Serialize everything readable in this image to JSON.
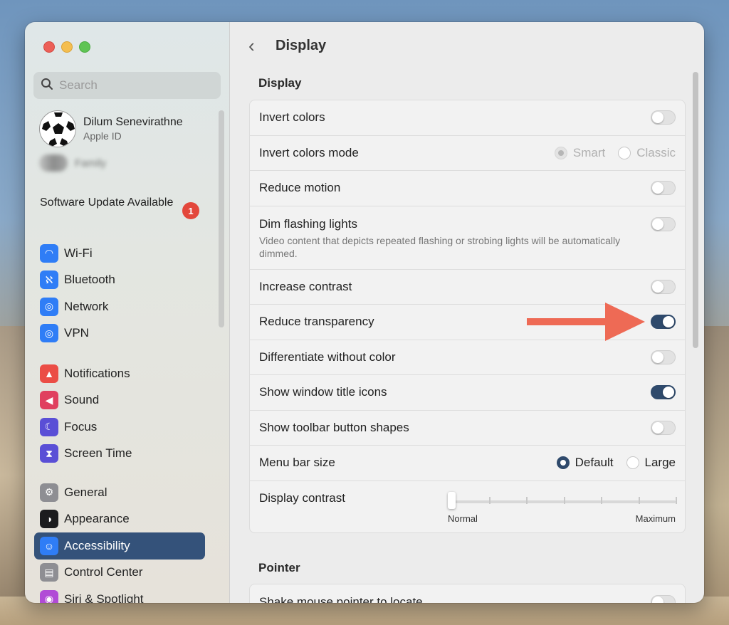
{
  "sidebar": {
    "search_placeholder": "Search",
    "profile": {
      "name": "Dilum Senevirathne",
      "subtitle": "Apple ID"
    },
    "family_label": "Family",
    "update": {
      "text": "Software Update Available",
      "badge": "1"
    },
    "groups": [
      [
        {
          "label": "Wi-Fi",
          "icon": "wifi-icon",
          "color": "#2f7df6",
          "glyph": "◠"
        },
        {
          "label": "Bluetooth",
          "icon": "bluetooth-icon",
          "color": "#2f7df6",
          "glyph": "ℵ"
        },
        {
          "label": "Network",
          "icon": "globe-icon",
          "color": "#2f7df6",
          "glyph": "◎"
        },
        {
          "label": "VPN",
          "icon": "vpn-globe-icon",
          "color": "#2f7df6",
          "glyph": "◎"
        }
      ],
      [
        {
          "label": "Notifications",
          "icon": "bell-icon",
          "color": "#eb4d45",
          "glyph": "▲"
        },
        {
          "label": "Sound",
          "icon": "speaker-icon",
          "color": "#e0405f",
          "glyph": "◀"
        },
        {
          "label": "Focus",
          "icon": "moon-icon",
          "color": "#5a4fd6",
          "glyph": "☾"
        },
        {
          "label": "Screen Time",
          "icon": "hourglass-icon",
          "color": "#5a4fd6",
          "glyph": "⧗"
        }
      ],
      [
        {
          "label": "General",
          "icon": "gear-icon",
          "color": "#8e8e93",
          "glyph": "⚙"
        },
        {
          "label": "Appearance",
          "icon": "appearance-icon",
          "color": "#1c1c1e",
          "glyph": "◑"
        },
        {
          "label": "Accessibility",
          "icon": "accessibility-icon",
          "color": "#2f7df6",
          "glyph": "☺",
          "active": true
        },
        {
          "label": "Control Center",
          "icon": "control-center-icon",
          "color": "#8e8e93",
          "glyph": "▤"
        },
        {
          "label": "Siri & Spotlight",
          "icon": "siri-icon",
          "color": "#b14bd6",
          "glyph": "◉"
        }
      ]
    ]
  },
  "main": {
    "title": "Display",
    "back_label": "‹",
    "display_section": "Display",
    "rows": [
      {
        "label": "Invert colors",
        "type": "toggle",
        "on": false
      },
      {
        "label": "Invert colors mode",
        "type": "radio",
        "disabled": true,
        "options": [
          "Smart",
          "Classic"
        ],
        "selected": 0
      },
      {
        "label": "Reduce motion",
        "type": "toggle",
        "on": false
      },
      {
        "label": "Dim flashing lights",
        "type": "toggle",
        "on": false,
        "desc": "Video content that depicts repeated flashing or strobing lights will be automatically dimmed."
      },
      {
        "label": "Increase contrast",
        "type": "toggle",
        "on": false
      },
      {
        "label": "Reduce transparency",
        "type": "toggle",
        "on": true
      },
      {
        "label": "Differentiate without color",
        "type": "toggle",
        "on": false
      },
      {
        "label": "Show window title icons",
        "type": "toggle",
        "on": true
      },
      {
        "label": "Show toolbar button shapes",
        "type": "toggle",
        "on": false
      },
      {
        "label": "Menu bar size",
        "type": "radio",
        "disabled": false,
        "options": [
          "Default",
          "Large"
        ],
        "selected": 0
      },
      {
        "label": "Display contrast",
        "type": "slider",
        "min_label": "Normal",
        "max_label": "Maximum",
        "value": 0
      }
    ],
    "pointer_section": "Pointer",
    "pointer_rows": [
      {
        "label": "Shake mouse pointer to locate",
        "type": "toggle",
        "on": false
      }
    ]
  },
  "annotation": {
    "arrow_color": "#ee6a55"
  }
}
